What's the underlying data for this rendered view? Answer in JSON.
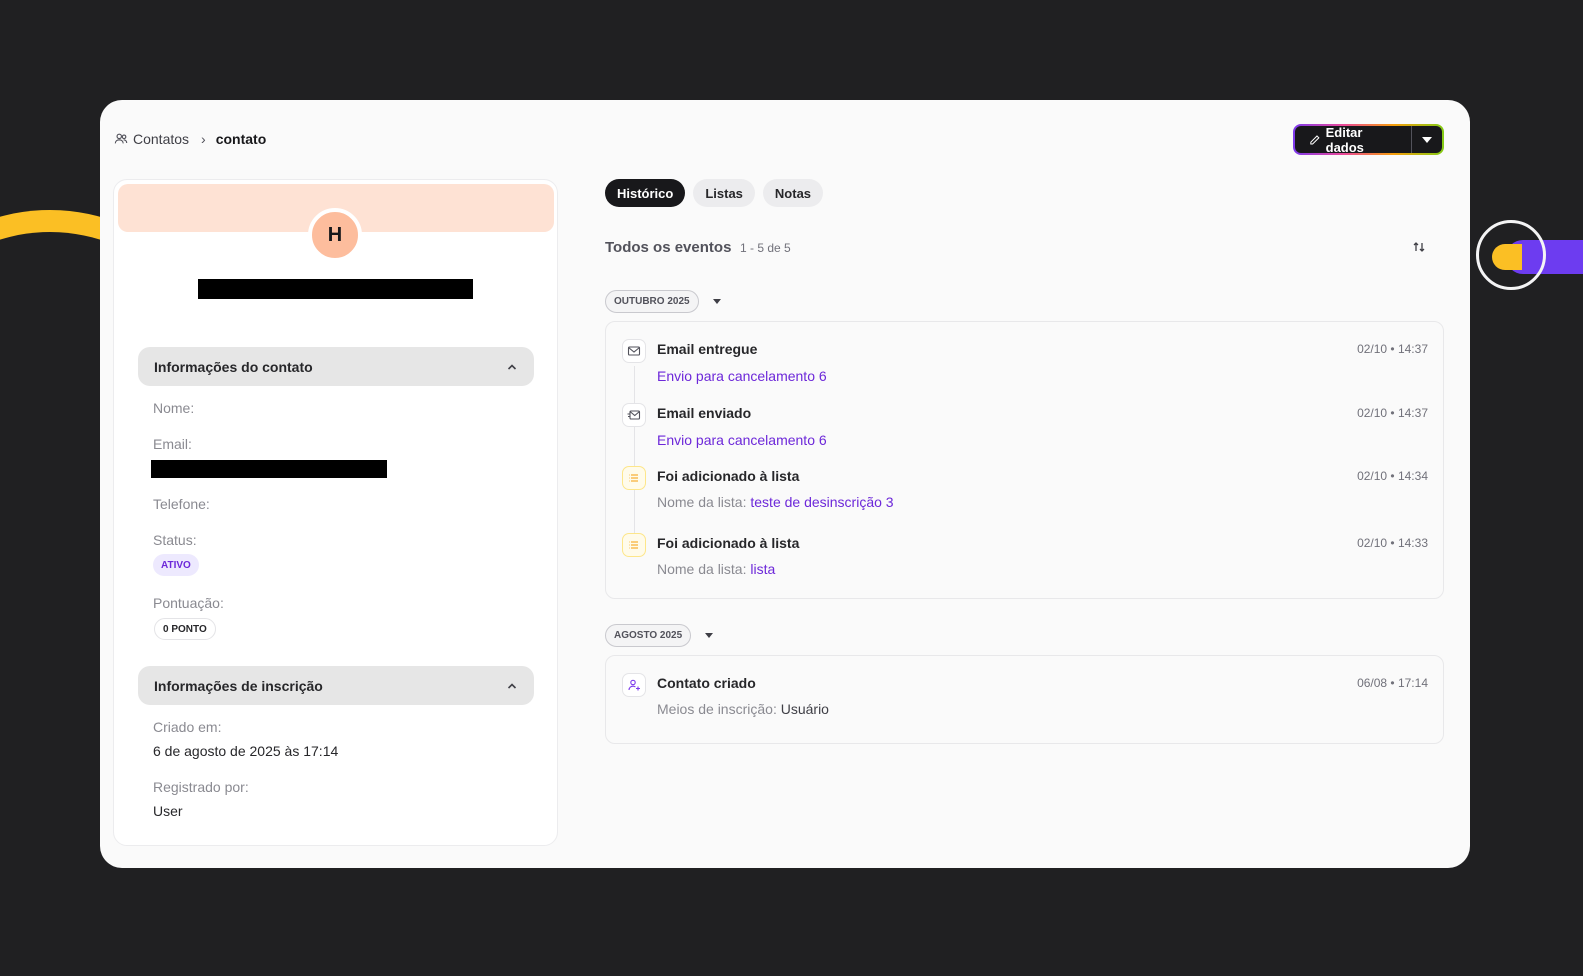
{
  "breadcrumb": {
    "root": "Contatos",
    "current": "contato"
  },
  "header": {
    "edit_label": "Editar dados"
  },
  "profile": {
    "avatar_initial": "H",
    "contact_section": {
      "title": "Informações do contato",
      "name_label": "Nome:",
      "email_label": "Email:",
      "phone_label": "Telefone:",
      "status_label": "Status:",
      "status_value": "ATIVO",
      "score_label": "Pontuação:",
      "score_value": "0 PONTO"
    },
    "subscription_section": {
      "title": "Informações de inscrição",
      "created_label": "Criado em:",
      "created_value": "6 de agosto de 2025 às 17:14",
      "registered_label": "Registrado por:",
      "registered_value": "User"
    }
  },
  "tabs": [
    {
      "label": "Histórico",
      "active": true
    },
    {
      "label": "Listas",
      "active": false
    },
    {
      "label": "Notas",
      "active": false
    }
  ],
  "events_header": {
    "title": "Todos os eventos",
    "count": "1 - 5 de 5"
  },
  "groups": [
    {
      "month": "OUTUBRO 2025",
      "events": [
        {
          "icon": "mail-icon",
          "title": "Email entregue",
          "time": "02/10 • 14:37",
          "sub_label": "",
          "sub_link": "Envio para cancelamento 6"
        },
        {
          "icon": "mail-sent-icon",
          "title": "Email enviado",
          "time": "02/10 • 14:37",
          "sub_label": "",
          "sub_link": "Envio para cancelamento 6"
        },
        {
          "icon": "list-icon",
          "title": "Foi adicionado à lista",
          "time": "02/10 • 14:34",
          "sub_label": "Nome da lista:",
          "sub_link": "teste de desinscrição 3"
        },
        {
          "icon": "list-icon",
          "title": "Foi adicionado à lista",
          "time": "02/10 • 14:33",
          "sub_label": "Nome da lista:",
          "sub_link": "lista"
        }
      ]
    },
    {
      "month": "AGOSTO 2025",
      "events": [
        {
          "icon": "user-add-icon",
          "title": "Contato criado",
          "time": "06/08 • 17:14",
          "sub_label": "Meios de inscrição:",
          "sub_value": "Usuário"
        }
      ]
    }
  ]
}
